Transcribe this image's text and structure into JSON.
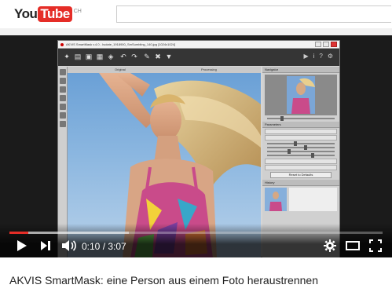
{
  "header": {
    "logo_you": "You",
    "logo_tube": "Tube",
    "logo_region": "CH",
    "search_placeholder": ""
  },
  "player": {
    "current_time": "0:10",
    "separator": " / ",
    "duration": "3:07",
    "progress_played": 0.05,
    "progress_loaded": 0.32
  },
  "app_window": {
    "title": "AKVIS SmartMask v.4.0 - Isolate_1918900_SmSumbling_140.jpg [1024x1024]",
    "tab_original": "Original",
    "tab_result": "Processing",
    "panel_navigator": "Navigator",
    "panel_parameters": "Parameters",
    "panel_history": "History",
    "btn_label": "Reset to Defaults"
  },
  "video": {
    "title": "AKVIS SmartMask: eine Person aus einem Foto heraustrennen"
  },
  "colors": {
    "brand_red": "#e52d27",
    "player_bg": "#1b1b1b"
  }
}
